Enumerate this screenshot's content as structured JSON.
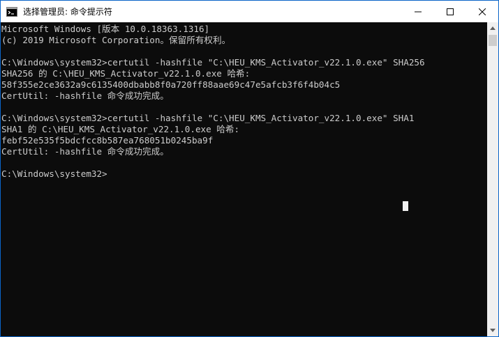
{
  "window": {
    "title": "选择管理员: 命令提示符",
    "controls": {
      "minimize": "minimize-icon",
      "maximize": "maximize-icon",
      "close": "close-icon"
    }
  },
  "console": {
    "lines": [
      "Microsoft Windows [版本 10.0.18363.1316]",
      "(c) 2019 Microsoft Corporation。保留所有权利。",
      "",
      "C:\\Windows\\system32>certutil -hashfile \"C:\\HEU_KMS_Activator_v22.1.0.exe\" SHA256",
      "SHA256 的 C:\\HEU_KMS_Activator_v22.1.0.exe 哈希:",
      "58f355e2ce3632a9c6135400dbabb8f0a720ff88aae69c47e5afcb3f6f4b04c5",
      "CertUtil: -hashfile 命令成功完成。",
      "",
      "C:\\Windows\\system32>certutil -hashfile \"C:\\HEU_KMS_Activator_v22.1.0.exe\" SHA1",
      "SHA1 的 C:\\HEU_KMS_Activator_v22.1.0.exe 哈希:",
      "febf52e535f5bdcfcc8b587ea768051b0245ba9f",
      "CertUtil: -hashfile 命令成功完成。",
      "",
      "C:\\Windows\\system32>"
    ]
  },
  "colors": {
    "console_bg": "#0c0c0c",
    "console_text": "#cccccc",
    "titlebar_bg": "#ffffff"
  }
}
